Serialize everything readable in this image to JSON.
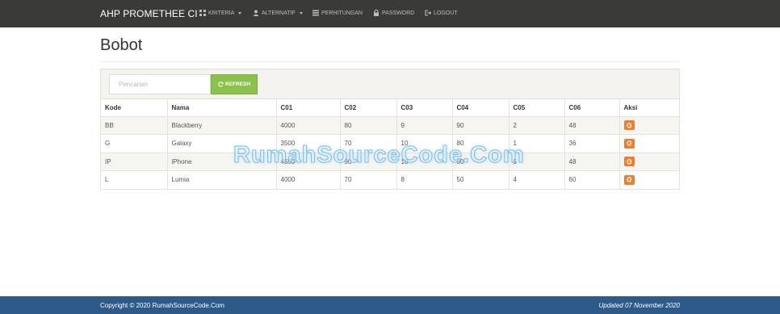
{
  "navbar": {
    "brand": "AHP PROMETHEE CI",
    "items": [
      {
        "label": "KRITERIA",
        "icon": "grid-icon",
        "dropdown": true
      },
      {
        "label": "ALTERNATIF",
        "icon": "user-icon",
        "dropdown": true
      },
      {
        "label": "PERHITUNGAN",
        "icon": "list-icon",
        "dropdown": false
      },
      {
        "label": "PASSWORD",
        "icon": "lock-icon",
        "dropdown": false
      },
      {
        "label": "LOGOUT",
        "icon": "logout-icon",
        "dropdown": false
      }
    ]
  },
  "page": {
    "title": "Bobot"
  },
  "toolbar": {
    "search_placeholder": "Pencarian",
    "search_value": "",
    "refresh_label": "REFRESH"
  },
  "table": {
    "headers": [
      "Kode",
      "Nama",
      "C01",
      "C02",
      "C03",
      "C04",
      "C05",
      "C06",
      "Aksi"
    ],
    "rows": [
      [
        "BB",
        "Blackberry",
        "4000",
        "80",
        "9",
        "90",
        "2",
        "48"
      ],
      [
        "G",
        "Galaxy",
        "3500",
        "70",
        "10",
        "80",
        "1",
        "36"
      ],
      [
        "IP",
        "iPhone",
        "4500",
        "90",
        "10",
        "60",
        "5",
        "48"
      ],
      [
        "L",
        "Lumia",
        "4000",
        "70",
        "8",
        "50",
        "4",
        "60"
      ]
    ],
    "action_icon": "edit-icon"
  },
  "watermark": "RumahSourceCode.Com",
  "footer": {
    "copyright": "Copyright © 2020 RumahSourceCode.Com",
    "updated": "Updated 07 November 2020"
  },
  "colors": {
    "navbar_bg": "#3a3a38",
    "refresh_button": "#8cc14c",
    "action_button": "#ee7d2c",
    "footer_bg": "#2e5a8a"
  }
}
